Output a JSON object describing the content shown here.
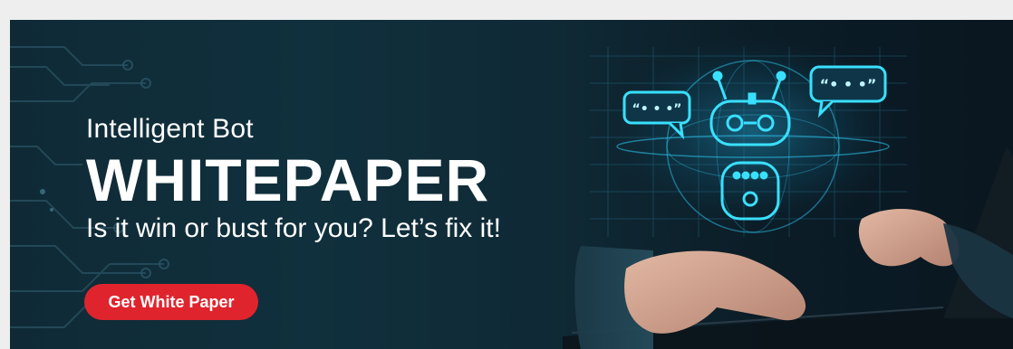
{
  "banner": {
    "kicker": "Intelligent Bot",
    "headline": "WHITEPAPER",
    "tagline": "Is it win or bust for you? Let’s fix it!",
    "cta_label": "Get White Paper",
    "speech_bubble_text": "“• • •”"
  },
  "colors": {
    "background": "#0f2a36",
    "cta": "#e0242d",
    "glow": "#2fd6ff",
    "text": "#ffffff"
  },
  "icons": [
    "circuit-pattern",
    "robot-icon",
    "speech-bubble-icon",
    "globe-hologram",
    "laptop"
  ]
}
